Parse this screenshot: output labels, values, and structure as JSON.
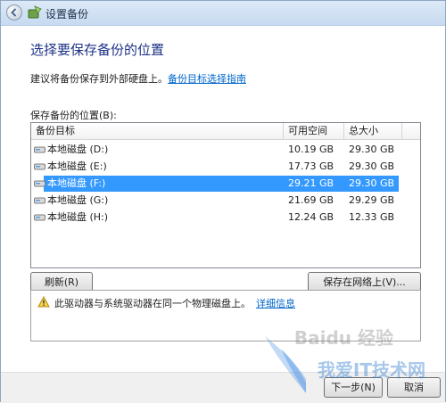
{
  "window": {
    "title": "设置备份"
  },
  "main": {
    "heading": "选择要保存备份的位置",
    "hint_text": "建议将备份保存到外部硬盘上。",
    "hint_link": "备份目标选择指南",
    "list_label": "保存备份的位置(B):"
  },
  "table": {
    "columns": [
      "备份目标",
      "可用空间",
      "总大小"
    ],
    "rows": [
      {
        "name": "本地磁盘 (D:)",
        "free": "10.19 GB",
        "total": "29.30 GB",
        "selected": false
      },
      {
        "name": "本地磁盘 (E:)",
        "free": "17.73 GB",
        "total": "29.30 GB",
        "selected": false
      },
      {
        "name": "本地磁盘 (F:)",
        "free": "29.21 GB",
        "total": "29.30 GB",
        "selected": true
      },
      {
        "name": "本地磁盘 (G:)",
        "free": "21.69 GB",
        "total": "29.29 GB",
        "selected": false
      },
      {
        "name": "本地磁盘 (H:)",
        "free": "12.24 GB",
        "total": "12.33 GB",
        "selected": false
      }
    ]
  },
  "buttons": {
    "refresh": "刷新(R)",
    "save_network": "保存在网络上(V)...",
    "next": "下一步(N)",
    "cancel": "取消"
  },
  "warning": {
    "text": "此驱动器与系统驱动器在同一个物理磁盘上。",
    "link": "详细信息"
  },
  "watermark": {
    "text1": "Baidu 经验",
    "text2": "我爱IT技术网"
  },
  "colors": {
    "selection": "#3399ff",
    "heading": "#1e3287",
    "link": "#0066cc"
  },
  "icons": [
    "back-arrow-icon",
    "backup-app-icon",
    "drive-icon",
    "warning-icon"
  ]
}
